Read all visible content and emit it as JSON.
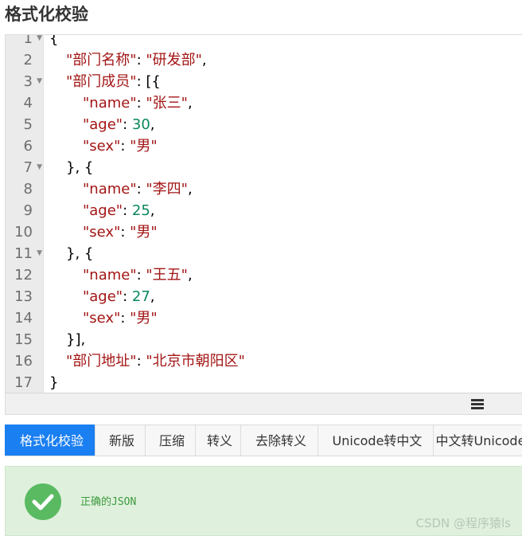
{
  "header": {
    "title": "格式化校验"
  },
  "editor": {
    "gutter": [
      {
        "num": "1",
        "fold": true
      },
      {
        "num": "2",
        "fold": false
      },
      {
        "num": "3",
        "fold": true
      },
      {
        "num": "4",
        "fold": false
      },
      {
        "num": "5",
        "fold": false
      },
      {
        "num": "6",
        "fold": false
      },
      {
        "num": "7",
        "fold": true
      },
      {
        "num": "8",
        "fold": false
      },
      {
        "num": "9",
        "fold": false
      },
      {
        "num": "10",
        "fold": false
      },
      {
        "num": "11",
        "fold": true
      },
      {
        "num": "12",
        "fold": false
      },
      {
        "num": "13",
        "fold": false
      },
      {
        "num": "14",
        "fold": false
      },
      {
        "num": "15",
        "fold": false
      },
      {
        "num": "16",
        "fold": false
      },
      {
        "num": "17",
        "fold": false
      }
    ],
    "lines": [
      [
        {
          "t": "{",
          "c": "p"
        }
      ],
      [
        {
          "t": "\"部门名称\"",
          "c": "k"
        },
        {
          "t": ": ",
          "c": "p"
        },
        {
          "t": "\"研发部\"",
          "c": "s"
        },
        {
          "t": ",",
          "c": "p"
        }
      ],
      [
        {
          "t": "\"部门成员\"",
          "c": "k"
        },
        {
          "t": ": [{",
          "c": "p"
        }
      ],
      [
        {
          "t": "\"name\"",
          "c": "k"
        },
        {
          "t": ": ",
          "c": "p"
        },
        {
          "t": "\"张三\"",
          "c": "s"
        },
        {
          "t": ",",
          "c": "p"
        }
      ],
      [
        {
          "t": "\"age\"",
          "c": "k"
        },
        {
          "t": ": ",
          "c": "p"
        },
        {
          "t": "30",
          "c": "n"
        },
        {
          "t": ",",
          "c": "p"
        }
      ],
      [
        {
          "t": "\"sex\"",
          "c": "k"
        },
        {
          "t": ": ",
          "c": "p"
        },
        {
          "t": "\"男\"",
          "c": "s"
        }
      ],
      [
        {
          "t": "}, {",
          "c": "p"
        }
      ],
      [
        {
          "t": "\"name\"",
          "c": "k"
        },
        {
          "t": ": ",
          "c": "p"
        },
        {
          "t": "\"李四\"",
          "c": "s"
        },
        {
          "t": ",",
          "c": "p"
        }
      ],
      [
        {
          "t": "\"age\"",
          "c": "k"
        },
        {
          "t": ": ",
          "c": "p"
        },
        {
          "t": "25",
          "c": "n"
        },
        {
          "t": ",",
          "c": "p"
        }
      ],
      [
        {
          "t": "\"sex\"",
          "c": "k"
        },
        {
          "t": ": ",
          "c": "p"
        },
        {
          "t": "\"男\"",
          "c": "s"
        }
      ],
      [
        {
          "t": "}, {",
          "c": "p"
        }
      ],
      [
        {
          "t": "\"name\"",
          "c": "k"
        },
        {
          "t": ": ",
          "c": "p"
        },
        {
          "t": "\"王五\"",
          "c": "s"
        },
        {
          "t": ",",
          "c": "p"
        }
      ],
      [
        {
          "t": "\"age\"",
          "c": "k"
        },
        {
          "t": ": ",
          "c": "p"
        },
        {
          "t": "27",
          "c": "n"
        },
        {
          "t": ",",
          "c": "p"
        }
      ],
      [
        {
          "t": "\"sex\"",
          "c": "k"
        },
        {
          "t": ": ",
          "c": "p"
        },
        {
          "t": "\"男\"",
          "c": "s"
        }
      ],
      [
        {
          "t": "}],",
          "c": "p"
        }
      ],
      [
        {
          "t": "\"部门地址\"",
          "c": "k"
        },
        {
          "t": ": ",
          "c": "p"
        },
        {
          "t": "\"北京市朝阳区\"",
          "c": "s"
        }
      ],
      [
        {
          "t": "}",
          "c": "p"
        }
      ]
    ]
  },
  "tabs": [
    {
      "label": "格式化校验",
      "active": true
    },
    {
      "label": "新版",
      "active": false
    },
    {
      "label": "压缩",
      "active": false
    },
    {
      "label": "转义",
      "active": false
    },
    {
      "label": "去除转义",
      "active": false
    },
    {
      "label": "Unicode转中文",
      "active": false
    },
    {
      "label": "中文转Unicode",
      "active": false
    }
  ],
  "result": {
    "message": "正确的JSON",
    "icon": "check-circle-icon",
    "color": "#5aba62"
  },
  "watermark": "CSDN @程序猿ls",
  "colors": {
    "accent": "#1a7ff1",
    "success_bg": "#dff1dd",
    "json_key": "#a31515",
    "json_number": "#09885a"
  }
}
